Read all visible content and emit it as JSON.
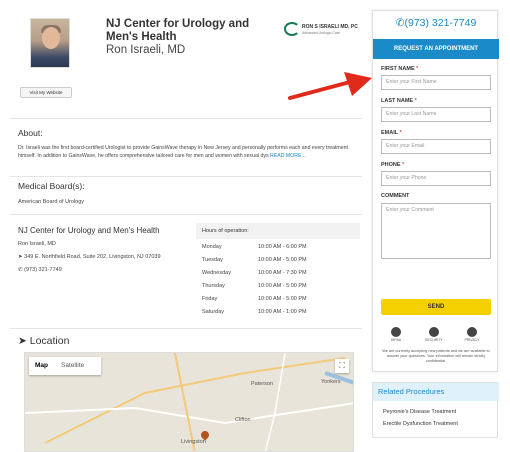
{
  "header": {
    "org_title": "NJ Center for Urology and Men's Health",
    "doctor_name": "Ron Israeli, MD",
    "logo_text": "RON S ISRAELI MD, PC",
    "logo_subtext": "Advanced Urologic Care",
    "visit_button": "Visit My Website"
  },
  "about": {
    "title": "About:",
    "text": "Dr. Israeli was the first board-certified Urologist to provide GainsWave therapy in New Jersey and personally performs each and every treatment himself. In addition to GainsWave, he offers comprehensive tailored care for men and women with sexual dys",
    "read_more": "READ MORE..."
  },
  "boards": {
    "title": "Medical Board(s):",
    "value": "American Board of Urology"
  },
  "office": {
    "title": "NJ Center for Urology and Men's Health",
    "doctor": "Ron Israeli, MD",
    "address": "349 E. Northfield Road, Suite 202, Livingston, NJ 07039",
    "phone": "(973) 321-7749",
    "hours_title": "Hours of operation:",
    "hours": [
      {
        "day": "Monday",
        "time": "10:00 AM - 6:00 PM"
      },
      {
        "day": "Tuesday",
        "time": "10:00 AM - 5:00 PM"
      },
      {
        "day": "Wednesday",
        "time": "10:00 AM - 7:30 PM"
      },
      {
        "day": "Thursday",
        "time": "10:00 AM - 5:00 PM"
      },
      {
        "day": "Friday",
        "time": "10:00 AM - 5:00 PM"
      },
      {
        "day": "Saturday",
        "time": "10:00 AM - 1:00 PM"
      }
    ]
  },
  "location": {
    "title": "Location",
    "map_tab": "Map",
    "satellite_tab": "Satellite",
    "cities": [
      "Paterson",
      "Yonkers",
      "Clifton",
      "Livingston"
    ]
  },
  "sidebar": {
    "phone": "(973) 321-7749",
    "request_button": "REQUEST AN APPOINTMENT",
    "fields": {
      "first_name_label": "FIRST NAME",
      "first_name_placeholder": "Enter your First Name",
      "last_name_label": "LAST NAME",
      "last_name_placeholder": "Enter your Last Name",
      "email_label": "EMAIL",
      "email_placeholder": "Enter your Email",
      "phone_label": "PHONE",
      "phone_placeholder": "Enter your Phone",
      "comment_label": "COMMENT",
      "comment_placeholder": "Enter your Comment",
      "required_mark": "*"
    },
    "send_button": "SEND",
    "badges": [
      "HIPAA",
      "SECURITY",
      "PRIVACY"
    ],
    "disclaimer": "We are currently accepting new patients and we are available to answer your questions. Your information will remain strictly confidential."
  },
  "related": {
    "title": "Related Procedures",
    "items": [
      "Peyronie's Disease Treatment",
      "Erectile Dysfunction Treatment"
    ]
  },
  "colors": {
    "accent": "#1a8ac9",
    "send": "#f5d000",
    "arrow": "#e02a1a"
  }
}
